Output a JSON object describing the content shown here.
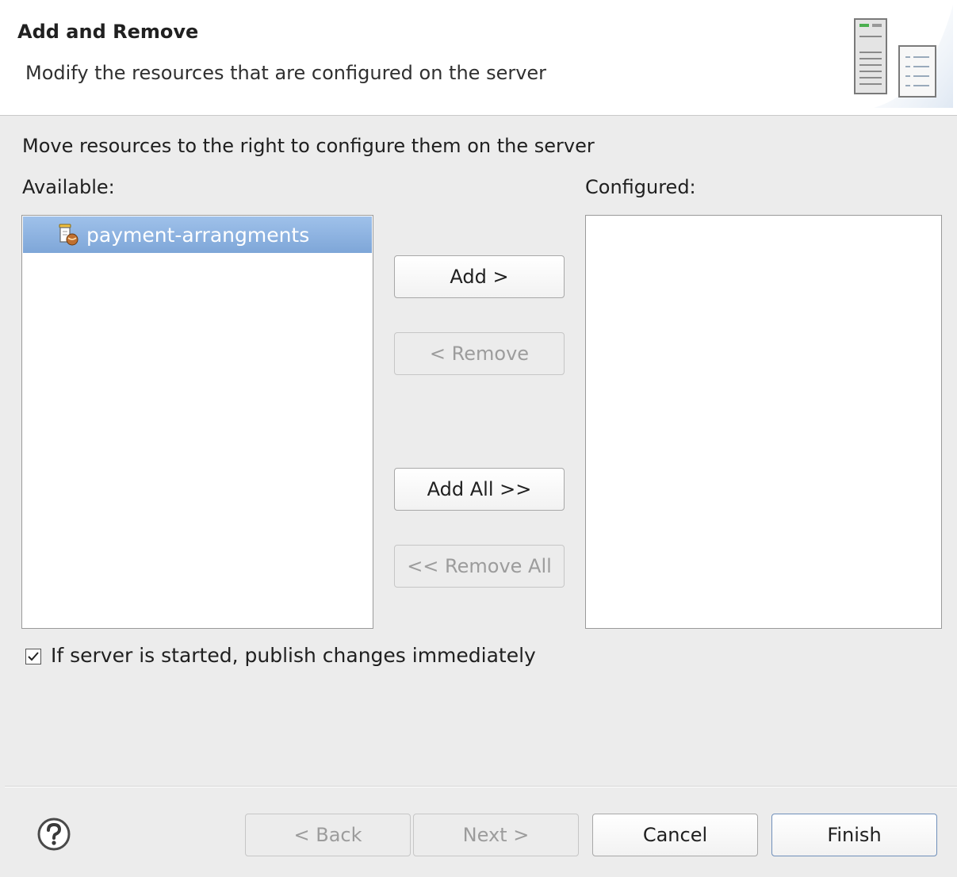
{
  "header": {
    "title": "Add and Remove",
    "description": "Modify the resources that are configured on the server",
    "icon": "server-configuration-icon"
  },
  "main": {
    "instruction": "Move resources to the right to configure them on the server",
    "available_label": "Available:",
    "configured_label": "Configured:",
    "available_items": [
      {
        "label": "payment-arrangments",
        "icon": "web-module-icon",
        "selected": true
      }
    ],
    "configured_items": []
  },
  "buttons": {
    "add": "Add >",
    "remove": "< Remove",
    "add_all": "Add All >>",
    "remove_all": "<< Remove All"
  },
  "publish_option": {
    "label": "If server is started, publish changes immediately",
    "checked": true
  },
  "footer": {
    "help_icon": "help-icon",
    "back": "< Back",
    "next": "Next >",
    "cancel": "Cancel",
    "finish": "Finish"
  },
  "colors": {
    "selection": "#8db3e2",
    "background": "#ececec",
    "disabled_text": "#9c9c9c"
  }
}
